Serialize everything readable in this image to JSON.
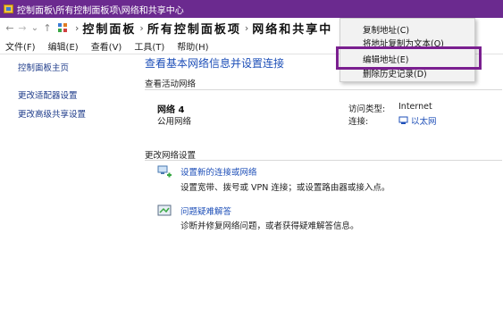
{
  "window": {
    "title": "控制面板\\所有控制面板项\\网络和共享中心"
  },
  "address_bar": {
    "back_glyph": "←",
    "forward_glyph": "→",
    "dropdown_glyph": "⌄",
    "up_glyph": "↑",
    "separator": "›",
    "crumbs": [
      "控制面板",
      "所有控制面板项",
      "网络和共享中"
    ]
  },
  "menu_bar": {
    "items": [
      "文件(F)",
      "编辑(E)",
      "查看(V)",
      "工具(T)",
      "帮助(H)"
    ]
  },
  "left_pane": {
    "links": [
      "控制面板主页",
      "更改适配器设置",
      "更改高级共享设置"
    ]
  },
  "main": {
    "title": "查看基本网络信息并设置连接",
    "active_networks_label": "查看活动网络",
    "network": {
      "name": "网络 4",
      "type": "公用网络",
      "access_type_label": "访问类型:",
      "access_type_value": "Internet",
      "connection_label": "连接:",
      "connection_value": "以太网"
    },
    "change_settings_label": "更改网络设置",
    "tasks": [
      {
        "title": "设置新的连接或网络",
        "desc": "设置宽带、拨号或 VPN 连接；或设置路由器或接入点。"
      },
      {
        "title": "问题疑难解答",
        "desc": "诊断并修复网络问题，或者获得疑难解答信息。"
      }
    ]
  },
  "context_menu": {
    "items": [
      "复制地址(C)",
      "将地址复制为文本(O)",
      "编辑地址(E)",
      "删除历史记录(D)"
    ],
    "highlighted_index": 2
  },
  "colors": {
    "titlebar": "#6b2a8f",
    "link": "#1e4fb8",
    "highlight_border": "#7a1f8f"
  }
}
